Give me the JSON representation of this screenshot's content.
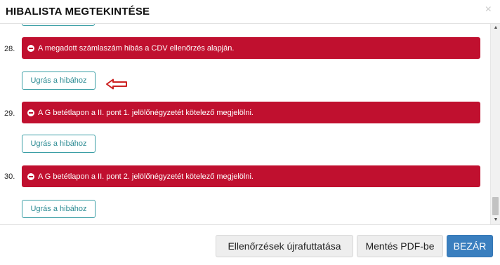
{
  "modal": {
    "title": "HIBALISTA MEGTEKINTÉSE",
    "close_symbol": "×"
  },
  "errors": [
    {
      "number": "28.",
      "message": "A megadott számlaszám hibás a CDV ellenőrzés alapján.",
      "icon": "minus-circle-icon",
      "button_label": "Ugrás a hibához"
    },
    {
      "number": "29.",
      "message": "A G betétlapon a II. pont 1. jelölőnégyzetét kötelező megjelölni.",
      "icon": "minus-circle-icon",
      "button_label": "Ugrás a hibához"
    },
    {
      "number": "30.",
      "message": "A G betétlapon a II. pont 2. jelölőnégyzetét kötelező megjelölni.",
      "icon": "minus-circle-icon",
      "button_label": "Ugrás a hibához"
    }
  ],
  "annotation": {
    "icon": "left-arrow-icon",
    "color": "#cc2222"
  },
  "footer": {
    "rerun_label": "Ellenőrzések újrafuttatása",
    "pdf_label": "Mentés PDF-be",
    "close_label": "BEZÁR"
  },
  "colors": {
    "error_bg": "#c0102f",
    "button_border": "#3a9ea5",
    "primary": "#3a7fbf"
  }
}
